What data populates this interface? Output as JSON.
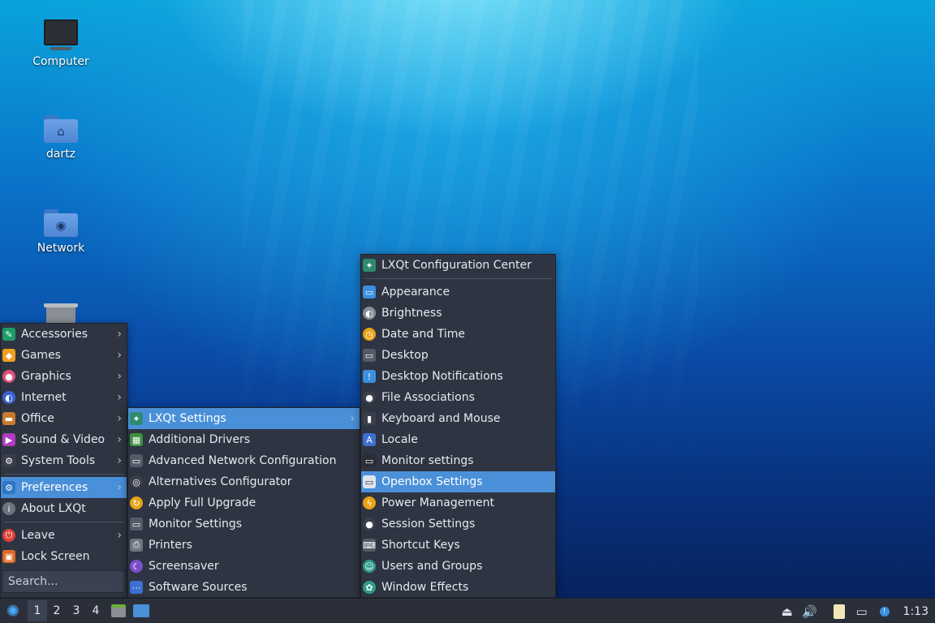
{
  "desktop": {
    "icons": [
      {
        "label": "Computer"
      },
      {
        "label": "dartz"
      },
      {
        "label": "Network"
      }
    ]
  },
  "main_menu": {
    "items": [
      {
        "label": "Accessories",
        "icon": "accessories-icon",
        "color": "#1e9c6a"
      },
      {
        "label": "Games",
        "icon": "games-icon",
        "color": "#f0a020"
      },
      {
        "label": "Graphics",
        "icon": "graphics-icon",
        "color": "#e04f7a"
      },
      {
        "label": "Internet",
        "icon": "internet-icon",
        "color": "#3b63d6"
      },
      {
        "label": "Office",
        "icon": "office-icon",
        "color": "#c97a2e"
      },
      {
        "label": "Sound & Video",
        "icon": "sound-video-icon",
        "color": "#b03cc0"
      },
      {
        "label": "System Tools",
        "icon": "system-tools-icon",
        "color": "#3a3f4a"
      },
      {
        "label": "Preferences",
        "icon": "preferences-icon",
        "color": "#2f77c6"
      },
      {
        "label": "About LXQt",
        "icon": "about-icon",
        "color": "#6e7480"
      },
      {
        "label": "Leave",
        "icon": "leave-icon",
        "color": "#e0413a"
      },
      {
        "label": "Lock Screen",
        "icon": "lock-icon",
        "color": "#e06a2a"
      }
    ],
    "search_placeholder": "Search..."
  },
  "preferences_menu": {
    "items": [
      {
        "label": "LXQt Settings",
        "icon": "lxqt-icon",
        "color": "#2e8b6e"
      },
      {
        "label": "Additional Drivers",
        "icon": "drivers-icon",
        "color": "#3e8f3e"
      },
      {
        "label": "Advanced Network Configuration",
        "icon": "network-config-icon",
        "color": "#555b66"
      },
      {
        "label": "Alternatives Configurator",
        "icon": "alternatives-icon",
        "color": "#3a3f4a"
      },
      {
        "label": "Apply Full Upgrade",
        "icon": "upgrade-icon",
        "color": "#e8a317"
      },
      {
        "label": "Monitor Settings",
        "icon": "monitor-icon",
        "color": "#555b66"
      },
      {
        "label": "Printers",
        "icon": "printer-icon",
        "color": "#6e7480"
      },
      {
        "label": "Screensaver",
        "icon": "screensaver-icon",
        "color": "#7b4fc9"
      },
      {
        "label": "Software Sources",
        "icon": "software-sources-icon",
        "color": "#3b6fd1"
      }
    ]
  },
  "lxqt_settings_menu": {
    "items": [
      {
        "label": "LXQt Configuration Center",
        "icon": "lxqt-config-icon",
        "color": "#2e8b6e"
      },
      {
        "label": "Appearance",
        "icon": "appearance-icon",
        "color": "#3b8fe0"
      },
      {
        "label": "Brightness",
        "icon": "brightness-icon",
        "color": "#8a8f96"
      },
      {
        "label": "Date and Time",
        "icon": "clock-icon",
        "color": "#e8a317"
      },
      {
        "label": "Desktop",
        "icon": "desktop-icon",
        "color": "#555b66"
      },
      {
        "label": "Desktop Notifications",
        "icon": "notifications-icon",
        "color": "#3b8fe0"
      },
      {
        "label": "File Associations",
        "icon": "file-assoc-icon",
        "color": "#3a3f4a"
      },
      {
        "label": "Keyboard and Mouse",
        "icon": "keyboard-mouse-icon",
        "color": "#3a3f4a"
      },
      {
        "label": "Locale",
        "icon": "locale-icon",
        "color": "#3b6fd1"
      },
      {
        "label": "Monitor settings",
        "icon": "monitor-icon",
        "color": "#2a2d33"
      },
      {
        "label": "Openbox Settings",
        "icon": "openbox-icon",
        "color": "#dfe3ea"
      },
      {
        "label": "Power Management",
        "icon": "power-icon",
        "color": "#e8a317"
      },
      {
        "label": "Session Settings",
        "icon": "session-icon",
        "color": "#3a3f4a"
      },
      {
        "label": "Shortcut Keys",
        "icon": "keyboard-icon",
        "color": "#555b66"
      },
      {
        "label": "Users and Groups",
        "icon": "users-icon",
        "color": "#2e9c8a"
      },
      {
        "label": "Window Effects",
        "icon": "window-effects-icon",
        "color": "#2e9c8a"
      }
    ]
  },
  "taskbar": {
    "desktops": [
      "1",
      "2",
      "3",
      "4"
    ],
    "clock": "1:13"
  },
  "colors": {
    "menu_bg": "#2e3441",
    "highlight": "#4a90d9",
    "taskbar_bg": "#2a2f3a"
  }
}
